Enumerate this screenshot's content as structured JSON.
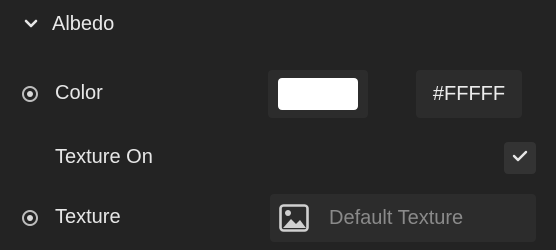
{
  "section": {
    "title": "Albedo",
    "expanded": true,
    "icon": "chevron-down-icon"
  },
  "color": {
    "label": "Color",
    "swatch_color": "#FFFFFF",
    "hex_value": "#FFFFF"
  },
  "texture_on": {
    "label": "Texture On",
    "checked": true,
    "icon": "checkmark-icon"
  },
  "texture": {
    "label": "Texture",
    "value": "Default Texture",
    "icon": "image-icon"
  },
  "colors": {
    "background": "#232323",
    "field": "#2c2c2c",
    "placeholder_text": "#8a8a8a"
  }
}
